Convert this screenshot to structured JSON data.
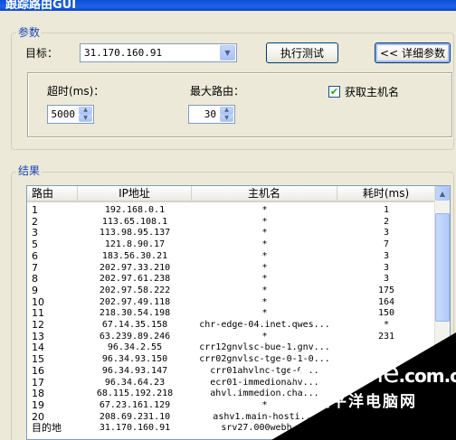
{
  "window": {
    "title": "跟踪路由GUI"
  },
  "params": {
    "group_label": "参数",
    "target_label": "目标：",
    "target_value": "31.170.160.91",
    "run_button": "执行测试",
    "details_button": "<< 详细参数",
    "timeout_label": "超时(ms)：",
    "timeout_value": "5000",
    "max_hops_label": "最大路由：",
    "max_hops_value": "30",
    "resolve_hostname_label": "获取主机名",
    "resolve_hostname_checked": true
  },
  "results": {
    "group_label": "结果",
    "columns": [
      "路由",
      "IP地址",
      "主机名",
      "耗时(ms)"
    ],
    "rows": [
      [
        "1",
        "192.168.0.1",
        "*",
        "1"
      ],
      [
        "2",
        "113.65.108.1",
        "*",
        "2"
      ],
      [
        "3",
        "113.98.95.137",
        "*",
        "3"
      ],
      [
        "5",
        "121.8.90.17",
        "*",
        "7"
      ],
      [
        "6",
        "183.56.30.21",
        "*",
        "3"
      ],
      [
        "7",
        "202.97.33.210",
        "*",
        "3"
      ],
      [
        "8",
        "202.97.61.238",
        "*",
        "3"
      ],
      [
        "9",
        "202.97.58.222",
        "*",
        "175"
      ],
      [
        "10",
        "202.97.49.118",
        "*",
        "164"
      ],
      [
        "11",
        "218.30.54.198",
        "*",
        "150"
      ],
      [
        "12",
        "67.14.35.158",
        "chr-edge-04.inet.qwes...",
        "*"
      ],
      [
        "13",
        "63.239.89.246",
        "*",
        "231"
      ],
      [
        "14",
        "96.34.2.55",
        "crr12gnvlsc-bue-1.gnv...",
        ""
      ],
      [
        "15",
        "96.34.93.150",
        "crr02gnvlsc-tge-0-1-0...",
        ""
      ],
      [
        "16",
        "96.34.93.147",
        "crr01ahvlnc-tge-0...",
        ""
      ],
      [
        "17",
        "96.34.64.23",
        "ecr01-immedionahv...",
        ""
      ],
      [
        "18",
        "68.115.192.218",
        "ahvl.immedion.cha...",
        ""
      ],
      [
        "19",
        "67.23.161.129",
        "*",
        ""
      ],
      [
        "20",
        "208.69.231.10",
        "ashv1.main-hosti...",
        ""
      ],
      [
        "目的地",
        "31.170.160.91",
        "srv27.000webh...",
        ""
      ]
    ]
  },
  "watermark": {
    "brand": "PConline",
    "brand_suffix": ".com.cn",
    "sub": "太平洋电脑网"
  }
}
